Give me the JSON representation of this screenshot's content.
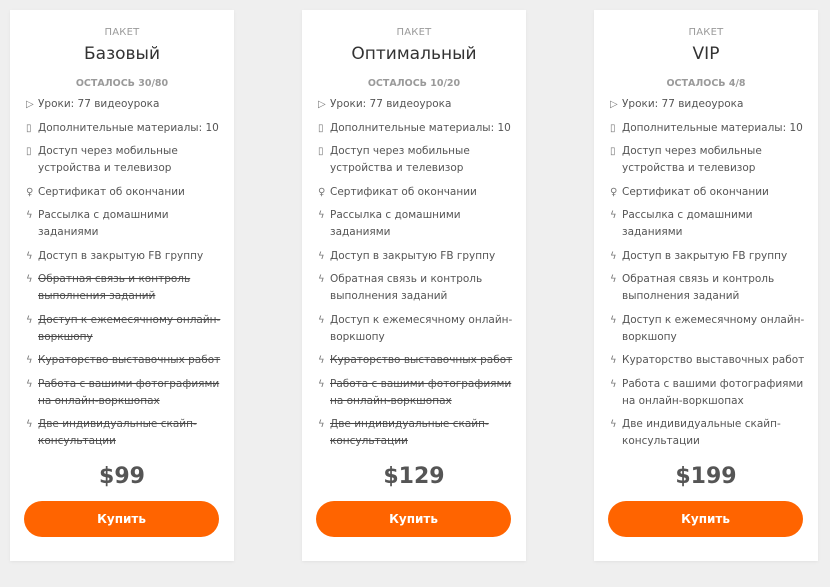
{
  "plans": [
    {
      "kicker": "ПАКЕТ",
      "title": "Базовый",
      "remaining": "ОСТАЛОСЬ 30/80",
      "price": "$99",
      "button_label": "Купить",
      "features": [
        {
          "icon": "play-icon",
          "icon_glyph": "▷",
          "text": "Уроки: 77 видеоурока",
          "available": true
        },
        {
          "icon": "document-icon",
          "icon_glyph": "▯",
          "text": "Дополнительные материалы: 10",
          "available": true
        },
        {
          "icon": "mobile-icon",
          "icon_glyph": "▯",
          "text": "Доступ через мобильные устройства и телевизор",
          "available": true
        },
        {
          "icon": "lightbulb-icon",
          "icon_glyph": "♀",
          "text": "Сертификат об окончании",
          "available": true
        },
        {
          "icon": "bolt-icon",
          "icon_glyph": "ϟ",
          "text": "Рассылка с домашними заданиями",
          "available": true
        },
        {
          "icon": "bolt-icon",
          "icon_glyph": "ϟ",
          "text": "Доступ в закрытую FB группу",
          "available": true
        },
        {
          "icon": "bolt-icon",
          "icon_glyph": "ϟ",
          "text": "Обратная связь и контроль выполнения заданий",
          "available": false
        },
        {
          "icon": "bolt-icon",
          "icon_glyph": "ϟ",
          "text": "Доступ к ежемесячному онлайн-воркшопу",
          "available": false
        },
        {
          "icon": "bolt-icon",
          "icon_glyph": "ϟ",
          "text": "Кураторство выставочных работ",
          "available": false
        },
        {
          "icon": "bolt-icon",
          "icon_glyph": "ϟ",
          "text": "Работа с вашими фотографиями на онлайн-воркшопах",
          "available": false
        },
        {
          "icon": "bolt-icon",
          "icon_glyph": "ϟ",
          "text": "Две индивидуальные скайп-консультации",
          "available": false
        }
      ]
    },
    {
      "kicker": "ПАКЕТ",
      "title": "Оптимальный",
      "remaining": "ОСТАЛОСЬ 10/20",
      "price": "$129",
      "button_label": "Купить",
      "features": [
        {
          "icon": "play-icon",
          "icon_glyph": "▷",
          "text": "Уроки: 77 видеоурока",
          "available": true
        },
        {
          "icon": "document-icon",
          "icon_glyph": "▯",
          "text": "Дополнительные материалы: 10",
          "available": true
        },
        {
          "icon": "mobile-icon",
          "icon_glyph": "▯",
          "text": "Доступ через мобильные устройства и телевизор",
          "available": true
        },
        {
          "icon": "lightbulb-icon",
          "icon_glyph": "♀",
          "text": "Сертификат об окончании",
          "available": true
        },
        {
          "icon": "bolt-icon",
          "icon_glyph": "ϟ",
          "text": "Рассылка с домашними заданиями",
          "available": true
        },
        {
          "icon": "bolt-icon",
          "icon_glyph": "ϟ",
          "text": "Доступ в закрытую FB группу",
          "available": true
        },
        {
          "icon": "bolt-icon",
          "icon_glyph": "ϟ",
          "text": "Обратная связь и контроль выполнения заданий",
          "available": true
        },
        {
          "icon": "bolt-icon",
          "icon_glyph": "ϟ",
          "text": "Доступ к ежемесячному онлайн-воркшопу",
          "available": true
        },
        {
          "icon": "bolt-icon",
          "icon_glyph": "ϟ",
          "text": "Кураторство выставочных работ",
          "available": false
        },
        {
          "icon": "bolt-icon",
          "icon_glyph": "ϟ",
          "text": "Работа с вашими фотографиями на онлайн-воркшопах",
          "available": false
        },
        {
          "icon": "bolt-icon",
          "icon_glyph": "ϟ",
          "text": "Две индивидуальные скайп-консультации",
          "available": false
        }
      ]
    },
    {
      "kicker": "ПАКЕТ",
      "title": "VIP",
      "remaining": "ОСТАЛОСЬ 4/8",
      "price": "$199",
      "button_label": "Купить",
      "features": [
        {
          "icon": "play-icon",
          "icon_glyph": "▷",
          "text": "Уроки: 77 видеоурока",
          "available": true
        },
        {
          "icon": "document-icon",
          "icon_glyph": "▯",
          "text": "Дополнительные материалы: 10",
          "available": true
        },
        {
          "icon": "mobile-icon",
          "icon_glyph": "▯",
          "text": "Доступ через мобильные устройства и телевизор",
          "available": true
        },
        {
          "icon": "lightbulb-icon",
          "icon_glyph": "♀",
          "text": "Сертификат об окончании",
          "available": true
        },
        {
          "icon": "bolt-icon",
          "icon_glyph": "ϟ",
          "text": "Рассылка с домашними заданиями",
          "available": true
        },
        {
          "icon": "bolt-icon",
          "icon_glyph": "ϟ",
          "text": "Доступ в закрытую FB группу",
          "available": true
        },
        {
          "icon": "bolt-icon",
          "icon_glyph": "ϟ",
          "text": "Обратная связь и контроль выполнения заданий",
          "available": true
        },
        {
          "icon": "bolt-icon",
          "icon_glyph": "ϟ",
          "text": "Доступ к ежемесячному онлайн-воркшопу",
          "available": true
        },
        {
          "icon": "bolt-icon",
          "icon_glyph": "ϟ",
          "text": "Кураторство выставочных работ",
          "available": true
        },
        {
          "icon": "bolt-icon",
          "icon_glyph": "ϟ",
          "text": "Работа с вашими фотографиями на онлайн-воркшопах",
          "available": true
        },
        {
          "icon": "bolt-icon",
          "icon_glyph": "ϟ",
          "text": "Две индивидуальные скайп-консультации",
          "available": true
        }
      ]
    }
  ],
  "colors": {
    "accent": "#ff6400",
    "background": "#efefef",
    "card": "#ffffff",
    "text": "#555555",
    "muted": "#9a9a9a"
  }
}
